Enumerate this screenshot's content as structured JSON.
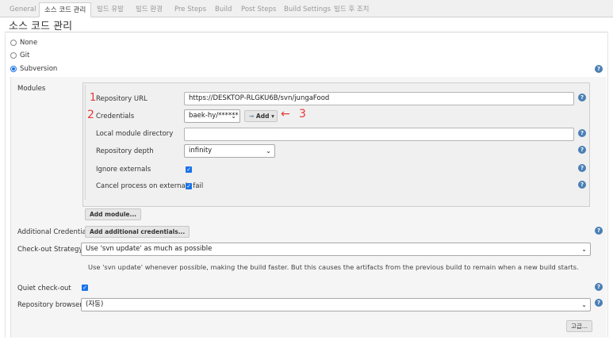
{
  "tabs": [
    {
      "label": "General",
      "active": false
    },
    {
      "label": "소스 코드 관리",
      "active": true
    },
    {
      "label": "빌드 유발",
      "active": false
    },
    {
      "label": "빌드 환경",
      "active": false
    },
    {
      "label": "Pre Steps",
      "active": false
    },
    {
      "label": "Build",
      "active": false
    },
    {
      "label": "Post Steps",
      "active": false
    },
    {
      "label": "Build Settings",
      "active": false
    },
    {
      "label": "빌드 후 조치",
      "active": false
    }
  ],
  "section_title": "소스 코드 관리",
  "scm_options": [
    {
      "label": "None",
      "checked": false
    },
    {
      "label": "Git",
      "checked": false
    },
    {
      "label": "Subversion",
      "checked": true
    }
  ],
  "modules": {
    "label": "Modules",
    "repository_url_label": "Repository URL",
    "repository_url_value": "https://DESKTOP-RLGKU6B/svn/jungaFood",
    "credentials_label": "Credentials",
    "credentials_value": "baek-hy/******",
    "add_button_label": "Add",
    "local_dir_label": "Local module directory",
    "local_dir_value": "",
    "depth_label": "Repository depth",
    "depth_value": "infinity",
    "ignore_externals_label": "Ignore externals",
    "ignore_externals_checked": true,
    "cancel_externals_label": "Cancel process on externals fail",
    "cancel_externals_checked": true,
    "add_module_button": "Add module..."
  },
  "additional_credentials": {
    "label": "Additional Credentials",
    "button": "Add additional credentials..."
  },
  "checkout_strategy": {
    "label": "Check-out Strategy",
    "value": "Use 'svn update' as much as possible",
    "description": "Use 'svn update' whenever possible, making the build faster. But this causes the artifacts from the previous build to remain when a new build starts."
  },
  "quiet_checkout": {
    "label": "Quiet check-out",
    "checked": true
  },
  "repository_browser": {
    "label": "Repository browser",
    "value": "(자동)"
  },
  "advanced_button": "고급...",
  "annotations": {
    "one": "1",
    "two": "2",
    "three": "3"
  },
  "colors": {
    "accent": "#1a73e8",
    "help_icon": "#4a7fb5",
    "annotation": "#e53935"
  }
}
